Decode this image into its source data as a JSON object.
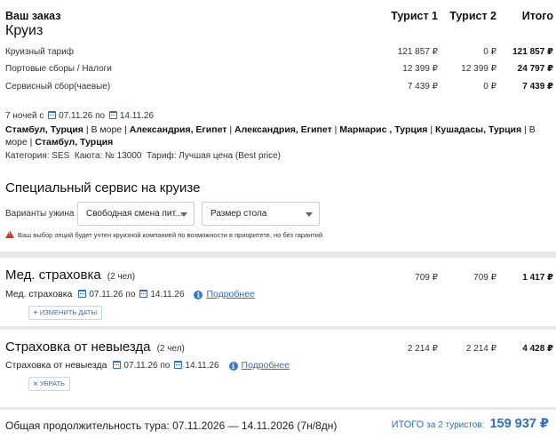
{
  "order": {
    "title": "Ваш заказ",
    "subtitle": "Круиз",
    "col_tourist1": "Турист 1",
    "col_tourist2": "Турист 2",
    "col_total": "Итого",
    "rows": [
      {
        "label": "Круизный тариф",
        "t1": "121 857 ₽",
        "t2": "0 ₽",
        "total": "121 857 ₽"
      },
      {
        "label": "Портовые сборы / Налоги",
        "t1": "12 399 ₽",
        "t2": "12 399 ₽",
        "total": "24 797 ₽"
      },
      {
        "label": "Сервисный сбор(чаевые)",
        "t1": "7 439 ₽",
        "t2": "0 ₽",
        "total": "7 439 ₽"
      }
    ]
  },
  "cruise": {
    "nights": "7 ночей с",
    "date_from": "07.11.26",
    "date_sep": "по",
    "date_to": "14.11.26",
    "route": [
      {
        "text": "Стамбул, Турция",
        "bold": true
      },
      {
        "text": "В море",
        "bold": false
      },
      {
        "text": "Александрия, Египет",
        "bold": true
      },
      {
        "text": "Александрия, Египет",
        "bold": true
      },
      {
        "text": "Мармарис , Турция",
        "bold": true
      },
      {
        "text": "Кушадасы, Турция",
        "bold": true
      },
      {
        "text": "В море",
        "bold": false
      },
      {
        "text": "Стамбул, Турция",
        "bold": true
      }
    ],
    "category": "Категория: SES",
    "cabin": "Каюта: № 13000",
    "tariff": "Тариф: Лучшая цена (Best price)"
  },
  "special": {
    "title": "Специальный сервис на круизе",
    "dinner_label": "Варианты ужина",
    "dinner_value": "Свободная смена пит...",
    "table_value": "Размер стола",
    "warning": "Ваш выбор опций будет учтен круизной компанией по возможности в приоритете, но без гарантий"
  },
  "med": {
    "title": "Мед. страховка",
    "count": "(2 чел)",
    "t1": "709 ₽",
    "t2": "709 ₽",
    "total": "1 417 ₽",
    "label": "Мед. страховка",
    "date_from": "07.11.26",
    "date_sep": "по",
    "date_to": "14.11.26",
    "more": "Подробнее",
    "change_btn": "изменить даты"
  },
  "cancel_ins": {
    "title": "Страховка от невыезда",
    "count": "(2 чел)",
    "t1": "2 214 ₽",
    "t2": "2 214 ₽",
    "total": "4 428 ₽",
    "label": "Страховка от невыезда",
    "date_from": "07.11.26",
    "date_sep": "по",
    "date_to": "14.11.26",
    "more": "Подробнее",
    "remove_btn": "убрать"
  },
  "footer": {
    "duration": "Общая продолжительность тура: 07.11.2026 — 14.11.2026 (7н/8дн)",
    "total_label_big": "ИТОГО",
    "total_label_small": "за 2 туристов:",
    "total_value": "159 937 ₽"
  },
  "colors": {
    "accent": "#2f6fc4",
    "warning": "#d8342c",
    "background": "#e9e9e9"
  }
}
